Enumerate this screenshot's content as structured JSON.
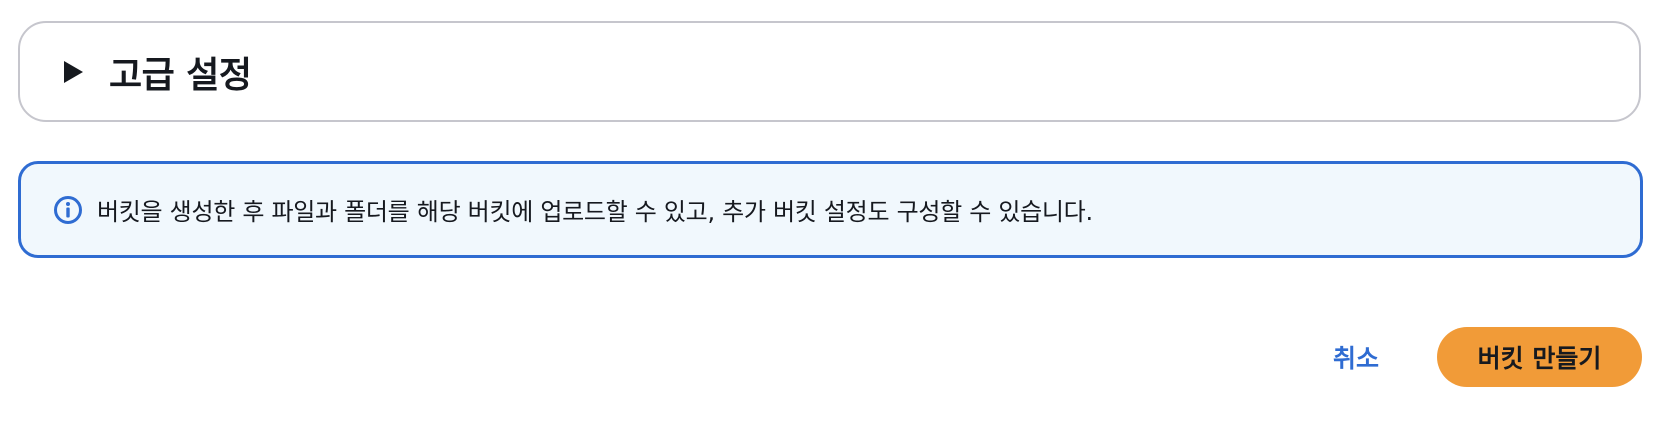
{
  "advanced_settings": {
    "title": "고급 설정",
    "expanded": false,
    "icon": "caret-right-icon"
  },
  "info_alert": {
    "icon": "info-circle-icon",
    "text": "버킷을 생성한 후 파일과 폴더를 해당 버킷에 업로드할 수 있고, 추가 버킷 설정도 구성할 수 있습니다.",
    "accent_color": "#2f6cd2",
    "background_color": "#f1f8fd"
  },
  "actions": {
    "cancel_label": "취소",
    "create_label": "버킷 만들기",
    "primary_color": "#f19b38",
    "link_color": "#2f6cd2"
  }
}
